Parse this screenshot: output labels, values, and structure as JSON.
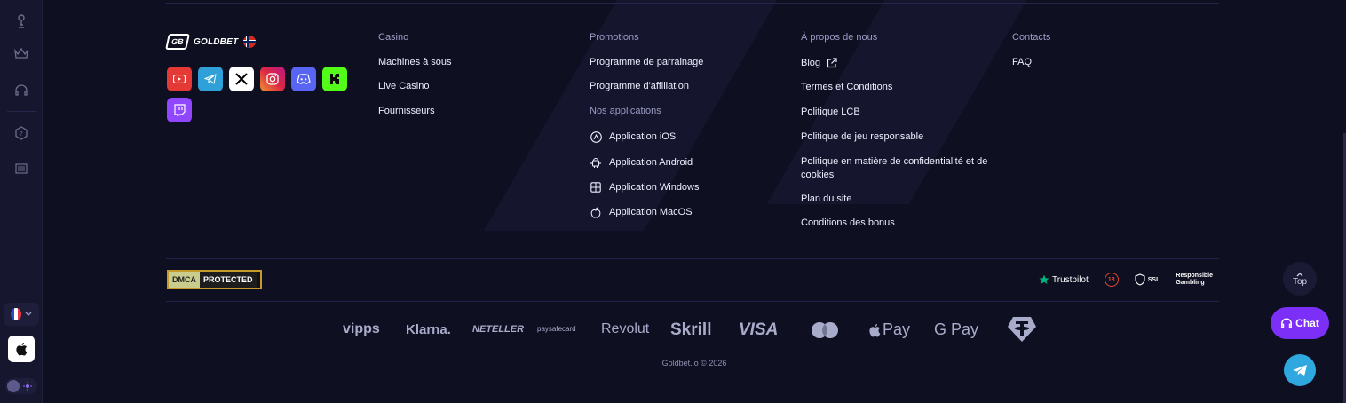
{
  "brand": {
    "logo_mark": "GB",
    "logo_text": "GOLDBET"
  },
  "columns": {
    "casino": {
      "title": "Casino",
      "links": [
        "Machines à sous",
        "Live Casino",
        "Fournisseurs"
      ]
    },
    "promotions": {
      "title": "Promotions",
      "links": [
        "Programme de parrainage",
        "Programme d'affiliation"
      ]
    },
    "apps": {
      "title": "Nos applications",
      "links": [
        "Application iOS",
        "Application Android",
        "Application Windows",
        "Application MacOS"
      ]
    },
    "about": {
      "title": "À propos de nous",
      "links": [
        "Blog",
        "Termes et Conditions",
        "Politique LCB",
        "Politique de jeu responsable",
        "Politique en matière de confidentialité et de cookies",
        "Plan du site",
        "Conditions des bonus"
      ]
    },
    "contacts": {
      "title": "Contacts",
      "links": [
        "FAQ"
      ]
    }
  },
  "dmca": {
    "left": "DMCA",
    "right": "PROTECTED"
  },
  "badges": {
    "trustpilot": "Trustpilot",
    "age": "18",
    "ssl": "SSL",
    "rg_line1": "Responsible",
    "rg_line2": "Gambling"
  },
  "payments": [
    "vipps",
    "Klarna.",
    "NETELLER",
    "paysafecard",
    "Revolut",
    "Skrill",
    "VISA",
    "Pay",
    "G Pay"
  ],
  "copyright": "Goldbet.io © 2026",
  "widgets": {
    "top_label": "Top",
    "chat_label": "Chat"
  },
  "colors": {
    "background": "#0f0f22",
    "accent": "#7b2ff7",
    "telegram": "#2fa8e0"
  }
}
